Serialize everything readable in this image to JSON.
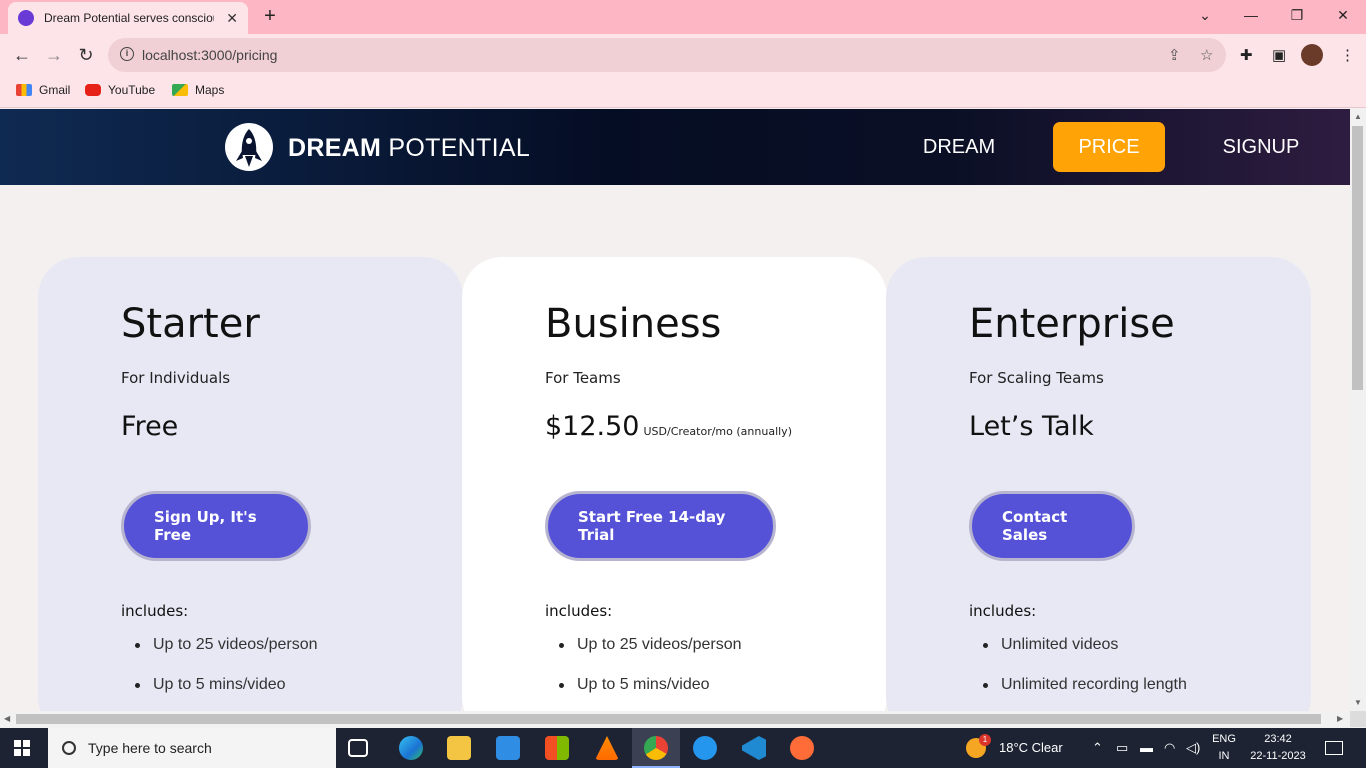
{
  "browser": {
    "tab_title": "Dream Potential serves conscious",
    "tab_close": "✕",
    "new_tab": "+",
    "url": "localhost:3000/pricing",
    "bookmarks": [
      {
        "label": "Gmail"
      },
      {
        "label": "YouTube"
      },
      {
        "label": "Maps"
      }
    ]
  },
  "header": {
    "logo_bold": "DREAM",
    "logo_light": " POTENTIAL",
    "nav": {
      "dream": "DREAM",
      "price": "PRICE",
      "signup": "SIGNUP"
    },
    "accent_color": "#ffa307"
  },
  "plans": [
    {
      "name": "Starter",
      "subtitle": "For Individuals",
      "price": "Free",
      "price_note": "",
      "cta": "Sign Up, It's Free",
      "includes_label": "includes:",
      "features": [
        "Up to 25 videos/person",
        "Up to 5 mins/video"
      ]
    },
    {
      "name": "Business",
      "subtitle": "For Teams",
      "price": "$12.50",
      "price_note": "USD/Creator/mo (annually)",
      "cta": "Start Free 14-day Trial",
      "includes_label": "includes:",
      "features": [
        "Up to 25 videos/person",
        "Up to 5 mins/video"
      ]
    },
    {
      "name": "Enterprise",
      "subtitle": "For Scaling Teams",
      "price": "Let’s Talk",
      "price_note": "",
      "cta": "Contact Sales",
      "includes_label": "includes:",
      "features": [
        "Unlimited videos",
        "Unlimited recording length"
      ]
    }
  ],
  "cta_color": "#5552d8",
  "taskbar": {
    "search_placeholder": "Type here to search",
    "weather": "18°C  Clear",
    "weather_badge": "1",
    "lang_top": "ENG",
    "lang_bottom": "IN",
    "time": "23:42",
    "date": "22-11-2023"
  }
}
